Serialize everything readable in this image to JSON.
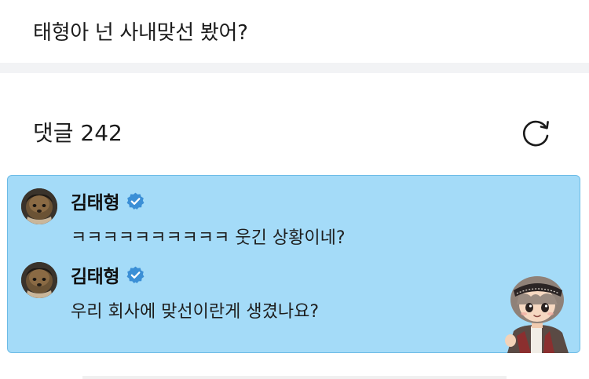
{
  "post": {
    "title": "태형아 넌 사내맞선 봤어?"
  },
  "comments_header": {
    "label": "댓글 242",
    "refresh_icon": "refresh-icon"
  },
  "highlight": {
    "background": "#a4dbf8",
    "border": "#6cbbe6",
    "comments": [
      {
        "author": "김태형",
        "verified": true,
        "text": "ㅋㅋㅋㅋㅋㅋㅋㅋㅋㅋ 웃긴 상황이네?"
      },
      {
        "author": "김태형",
        "verified": true,
        "text": "우리 회사에 맞선이란게 생겼나요?"
      }
    ]
  },
  "colors": {
    "verified": "#3b8fd6",
    "separator": "#f2f3f5"
  }
}
